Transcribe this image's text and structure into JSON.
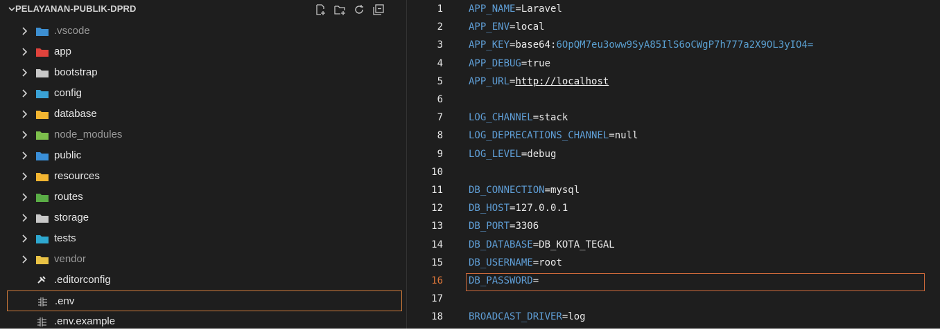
{
  "explorer": {
    "title": "PELAYANAN-PUBLIK-DPRD",
    "actions": [
      {
        "name": "new-file-icon"
      },
      {
        "name": "new-folder-icon"
      },
      {
        "name": "refresh-icon"
      },
      {
        "name": "collapse-all-icon"
      }
    ],
    "items": [
      {
        "label": ".vscode",
        "type": "folder",
        "color": "#3d8fd1",
        "dim": true,
        "icon": "vscode-folder-icon"
      },
      {
        "label": "app",
        "type": "folder",
        "color": "#e0433c",
        "dim": false,
        "icon": "app-folder-icon"
      },
      {
        "label": "bootstrap",
        "type": "folder",
        "color": "#c8c8c8",
        "dim": false,
        "icon": "folder-icon"
      },
      {
        "label": "config",
        "type": "folder",
        "color": "#3aa2d6",
        "dim": false,
        "icon": "config-folder-icon"
      },
      {
        "label": "database",
        "type": "folder",
        "color": "#f2b531",
        "dim": false,
        "icon": "database-folder-icon"
      },
      {
        "label": "node_modules",
        "type": "folder",
        "color": "#7dbf4c",
        "dim": true,
        "icon": "node-folder-icon"
      },
      {
        "label": "public",
        "type": "folder",
        "color": "#3a8fd8",
        "dim": false,
        "icon": "public-folder-icon"
      },
      {
        "label": "resources",
        "type": "folder",
        "color": "#f2b531",
        "dim": false,
        "icon": "resources-folder-icon"
      },
      {
        "label": "routes",
        "type": "folder",
        "color": "#5aad46",
        "dim": false,
        "icon": "routes-folder-icon"
      },
      {
        "label": "storage",
        "type": "folder",
        "color": "#c8c8c8",
        "dim": false,
        "icon": "folder-icon"
      },
      {
        "label": "tests",
        "type": "folder",
        "color": "#2ea8d0",
        "dim": false,
        "icon": "tests-folder-icon"
      },
      {
        "label": "vendor",
        "type": "folder",
        "color": "#e9c245",
        "dim": true,
        "icon": "vendor-folder-icon"
      },
      {
        "label": ".editorconfig",
        "type": "file",
        "color": "#e6e6e6",
        "dim": false,
        "icon": "editorconfig-icon"
      },
      {
        "label": ".env",
        "type": "file",
        "color": "#d0d0d0",
        "dim": false,
        "icon": "env-file-icon",
        "selected": true
      },
      {
        "label": ".env.example",
        "type": "file",
        "color": "#d0d0d0",
        "dim": false,
        "icon": "env-file-icon"
      }
    ]
  },
  "editor": {
    "current_line": 16,
    "lines": [
      {
        "n": "1",
        "key": "APP_NAME",
        "val": "Laravel",
        "cls": "v"
      },
      {
        "n": "2",
        "key": "APP_ENV",
        "val": "local",
        "cls": "v"
      },
      {
        "n": "3",
        "key": "APP_KEY",
        "val": "base64:",
        "cls": "v",
        "val2": "6OpQM7eu3oww9SyA85IlS6oCWgP7h777a2X9OL3yIO4=",
        "cls2": "v b64"
      },
      {
        "n": "4",
        "key": "APP_DEBUG",
        "val": "true",
        "cls": "v"
      },
      {
        "n": "5",
        "key": "APP_URL",
        "val": "http://localhost",
        "cls": "v url"
      },
      {
        "n": "6",
        "key": "",
        "val": "",
        "cls": "v"
      },
      {
        "n": "7",
        "key": "LOG_CHANNEL",
        "val": "stack",
        "cls": "v"
      },
      {
        "n": "8",
        "key": "LOG_DEPRECATIONS_CHANNEL",
        "val": "null",
        "cls": "v"
      },
      {
        "n": "9",
        "key": "LOG_LEVEL",
        "val": "debug",
        "cls": "v"
      },
      {
        "n": "10",
        "key": "",
        "val": "",
        "cls": "v"
      },
      {
        "n": "11",
        "key": "DB_CONNECTION",
        "val": "mysql",
        "cls": "v"
      },
      {
        "n": "12",
        "key": "DB_HOST",
        "val": "127.0.0.1",
        "cls": "v"
      },
      {
        "n": "13",
        "key": "DB_PORT",
        "val": "3306",
        "cls": "v"
      },
      {
        "n": "14",
        "key": "DB_DATABASE",
        "val": "DB_KOTA_TEGAL",
        "cls": "v"
      },
      {
        "n": "15",
        "key": "DB_USERNAME",
        "val": "root",
        "cls": "v"
      },
      {
        "n": "16",
        "key": "DB_PASSWORD",
        "val": "",
        "cls": "v"
      },
      {
        "n": "17",
        "key": "",
        "val": "",
        "cls": "v"
      },
      {
        "n": "18",
        "key": "BROADCAST_DRIVER",
        "val": "log",
        "cls": "v"
      }
    ]
  }
}
